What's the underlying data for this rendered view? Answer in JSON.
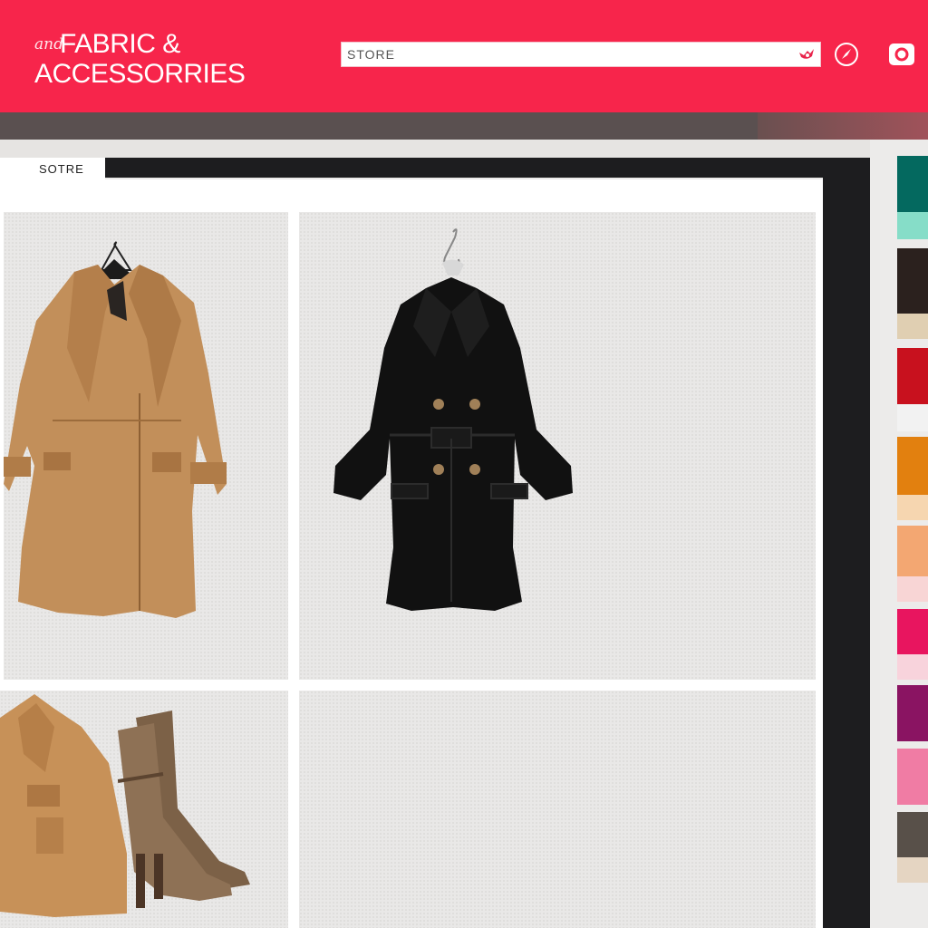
{
  "header": {
    "logo_script": "and",
    "logo_line1": "FABRIC &",
    "logo_line2": "ACCESSORRIES",
    "search_placeholder": "STORE"
  },
  "store": {
    "tab_label": "SOTRE"
  },
  "products": [
    {
      "name": "camel-wool-coat-icon"
    },
    {
      "name": "black-double-breasted-coat-icon"
    },
    {
      "name": "camel-cape-coat-icon"
    },
    {
      "name": "brown-knit-ankle-boots-icon"
    }
  ],
  "swatches": [
    {
      "top": "#04695f",
      "bottom": "#86ddc8"
    },
    {
      "top": "#2b211e",
      "bottom": "#e0cfb2"
    },
    {
      "top": "#c8111e",
      "bottom": "#f2f2f2"
    },
    {
      "top": "#e2800f",
      "bottom": "#f6d6b0"
    },
    {
      "top": "#f3a772",
      "bottom": "#f8d5d5"
    },
    {
      "top": "#e8155f",
      "bottom": "#f8d3dc"
    },
    {
      "top": "#8a1462",
      "bottom": "#f4e2ec"
    },
    {
      "top": "#f07ca4",
      "bottom": "#f9dbe4"
    },
    {
      "top": "#585049",
      "bottom": "#e5d5c2"
    }
  ],
  "colors": {
    "header_bg": "#f7254b",
    "dark_bar": "#1d1d1f"
  }
}
